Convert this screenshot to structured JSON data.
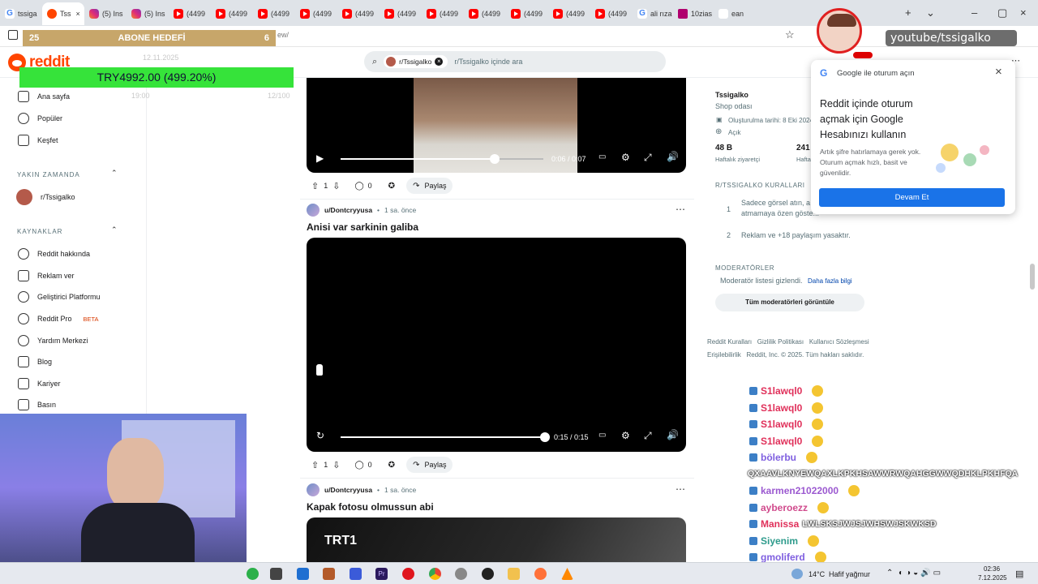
{
  "browser": {
    "tabs": [
      {
        "label": "tssiga",
        "icon": "google"
      },
      {
        "label": "Tss",
        "icon": "reddit",
        "active": true
      },
      {
        "label": "(5) Ins",
        "icon": "instagram"
      },
      {
        "label": "(5) Ins",
        "icon": "instagram"
      },
      {
        "label": "(4499",
        "icon": "youtube"
      },
      {
        "label": "(4499",
        "icon": "youtube"
      },
      {
        "label": "(4499",
        "icon": "youtube"
      },
      {
        "label": "(4499",
        "icon": "youtube"
      },
      {
        "label": "(4499",
        "icon": "youtube"
      },
      {
        "label": "(4499",
        "icon": "youtube"
      },
      {
        "label": "(4499",
        "icon": "youtube"
      },
      {
        "label": "(4499",
        "icon": "youtube"
      },
      {
        "label": "(4499",
        "icon": "youtube"
      },
      {
        "label": "(4499",
        "icon": "youtube"
      },
      {
        "label": "(4499",
        "icon": "youtube"
      },
      {
        "label": "ali rıza",
        "icon": "google"
      },
      {
        "label": "10zias",
        "icon": "m"
      },
      {
        "label": "ean",
        "icon": "other"
      }
    ],
    "url_fragment": "ew/"
  },
  "overlay": {
    "abone_left": "25",
    "abone_title": "ABONE HEDEFİ",
    "abone_right": "6",
    "donation": "TRY4992.00 (499.20%)",
    "youtube_handle": "youtube/tssigalko",
    "faded_date": "12.11.2025",
    "faded_time": "19:00",
    "faded_number": "12/100"
  },
  "reddit": {
    "logo": "reddit",
    "search": {
      "chip": "r/Tssigalko",
      "placeholder": "r/Tssigalko içinde ara"
    },
    "sidebar": {
      "items": [
        {
          "label": "Ana sayfa",
          "icon": "home-icon"
        },
        {
          "label": "Popüler",
          "icon": "popular-icon"
        },
        {
          "label": "Keşfet",
          "icon": "explore-icon"
        }
      ],
      "recent_header": "YAKIN ZAMANDA",
      "recent": [
        {
          "label": "r/Tssigalko"
        }
      ],
      "resources_header": "KAYNAKLAR",
      "resources": [
        {
          "label": "Reddit hakkında",
          "icon": "reddit-icon"
        },
        {
          "label": "Reklam ver",
          "icon": "megaphone-icon"
        },
        {
          "label": "Geliştirici Platformu",
          "icon": "code-icon"
        },
        {
          "label": "Reddit Pro",
          "icon": "pro-icon",
          "badge": "BETA"
        },
        {
          "label": "Yardım Merkezi",
          "icon": "help-icon"
        },
        {
          "label": "Blog",
          "icon": "blog-icon"
        },
        {
          "label": "Kariyer",
          "icon": "career-icon"
        },
        {
          "label": "Basın",
          "icon": "press-icon"
        }
      ]
    },
    "posts": [
      {
        "time": "0:06 / 0:07",
        "progress": 0.76,
        "votes": "1",
        "comments": "0",
        "share": "Paylaş"
      },
      {
        "user": "u/Dontcryyusa",
        "ago": "1 sa. önce",
        "title": "Anisi var sarkinin galiba",
        "time": "0:15 / 0:15",
        "progress": 1.0,
        "votes": "1",
        "comments": "0",
        "share": "Paylaş"
      },
      {
        "user": "u/Dontcryyusa",
        "ago": "1 sa. önce",
        "title": "Kapak fotosu olmussun abi",
        "thumb_text": "TRT1"
      }
    ],
    "right_sidebar": {
      "community": "Tssigalko",
      "subtitle": "Shop odası",
      "created": "Oluşturulma tarihi: 8 Eki 2024",
      "visibility": "Açık",
      "stat1_value": "48 B",
      "stat1_label": "Haftalık ziyaretçi",
      "stat2_value": "241",
      "stat2_label": "Hafta",
      "rules_header": "R/TSSIGALKO KURALLARI",
      "rules": [
        {
          "num": "1",
          "text_line1": "Sadece görsel atın, a",
          "text_line2": "atmamaya özen göste..."
        },
        {
          "num": "2",
          "text_line1": "Reklam ve +18 paylaşım yasaktır.",
          "text_line2": ""
        }
      ],
      "mods_header": "MODERATÖRLER",
      "mods_text": "Moderatör listesi gizlendi.",
      "mods_link": "Daha fazla bilgi",
      "mods_button": "Tüm moderatörleri görüntüle",
      "footer_line1": "Reddit Kuralları   Gizlilik Politikası   Kullanıcı Sözleşmesi",
      "footer_line2": "Erişilebilirlik   Reddit, Inc. © 2025. Tüm hakları saklıdır."
    },
    "google_popup": {
      "header": "Google ile oturum açın",
      "title": "Reddit içinde oturum açmak için Google Hesabınızı kullanın",
      "body": "Artık şifre hatırlamaya gerek yok. Oturum açmak hızlı, basit ve güvenlidir.",
      "button": "Devam Et"
    }
  },
  "chat": [
    {
      "name": "S1lawql0",
      "color": "#e0305a",
      "msg": ""
    },
    {
      "name": "S1lawql0",
      "color": "#e0305a",
      "msg": ""
    },
    {
      "name": "S1lawql0",
      "color": "#e0305a",
      "msg": ""
    },
    {
      "name": "S1lawql0",
      "color": "#e0305a",
      "msg": ""
    },
    {
      "name": "bölerbu",
      "color": "#7f5fe0",
      "msg": ""
    },
    {
      "name": "",
      "color": "#ffffff",
      "msg": "QXAAVLKNYEWQAXLKPKHSAWWRWQAHGGWWQDHKLPKHFQA"
    },
    {
      "name": "karmen21022000",
      "color": "#9b59d0",
      "msg": ""
    },
    {
      "name": "ayberoezz",
      "color": "#d04a8c",
      "msg": ""
    },
    {
      "name": "Manissa",
      "color": "#e0305a",
      "msg": "LWLSKSJWJSJWHSWJSKWKSD"
    },
    {
      "name": "Siyenim",
      "color": "#2e9b8c",
      "msg": ""
    },
    {
      "name": "gmoliferd",
      "color": "#7f5fe0",
      "msg": ""
    }
  ],
  "taskbar": {
    "weather_temp": "14°C",
    "weather_desc": "Hafif yağmur",
    "time": "02:36",
    "date": "7.12.2025"
  }
}
